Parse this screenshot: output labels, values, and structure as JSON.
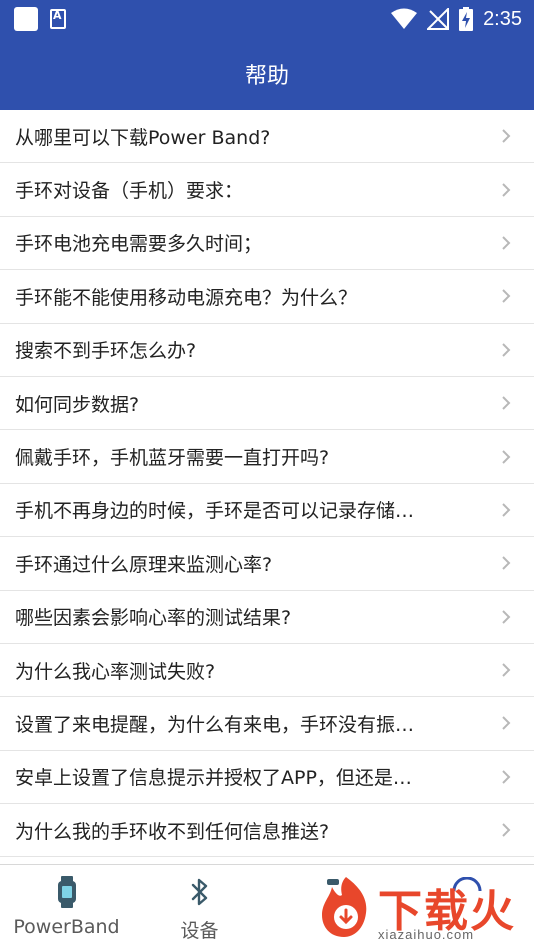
{
  "status_bar": {
    "time": "2:35"
  },
  "header": {
    "title": "帮助"
  },
  "help_items": [
    {
      "label": "从哪里可以下载Power Band?"
    },
    {
      "label": "手环对设备（手机）要求："
    },
    {
      "label": "手环电池充电需要多久时间；"
    },
    {
      "label": "手环能不能使用移动电源充电？为什么？"
    },
    {
      "label": "搜索不到手环怎么办?"
    },
    {
      "label": "如何同步数据?"
    },
    {
      "label": "佩戴手环，手机蓝牙需要一直打开吗?"
    },
    {
      "label": "手机不再身边的时候，手环是否可以记录存储…"
    },
    {
      "label": "手环通过什么原理来监测心率?"
    },
    {
      "label": "哪些因素会影响心率的测试结果?"
    },
    {
      "label": "为什么我心率测试失败?"
    },
    {
      "label": "设置了来电提醒，为什么有来电，手环没有振…"
    },
    {
      "label": "安卓上设置了信息提示并授权了APP，但还是…"
    },
    {
      "label": "为什么我的手环收不到任何信息推送?"
    }
  ],
  "bottom_nav": {
    "powerband_label": "PowerBand",
    "device_label": "设备"
  },
  "watermark": {
    "text": "下载火",
    "domain": "xiazaihuo.com"
  },
  "colors": {
    "primary": "#2f50ad",
    "chevron": "#b8b8b8",
    "watermark": "#e8472b"
  }
}
